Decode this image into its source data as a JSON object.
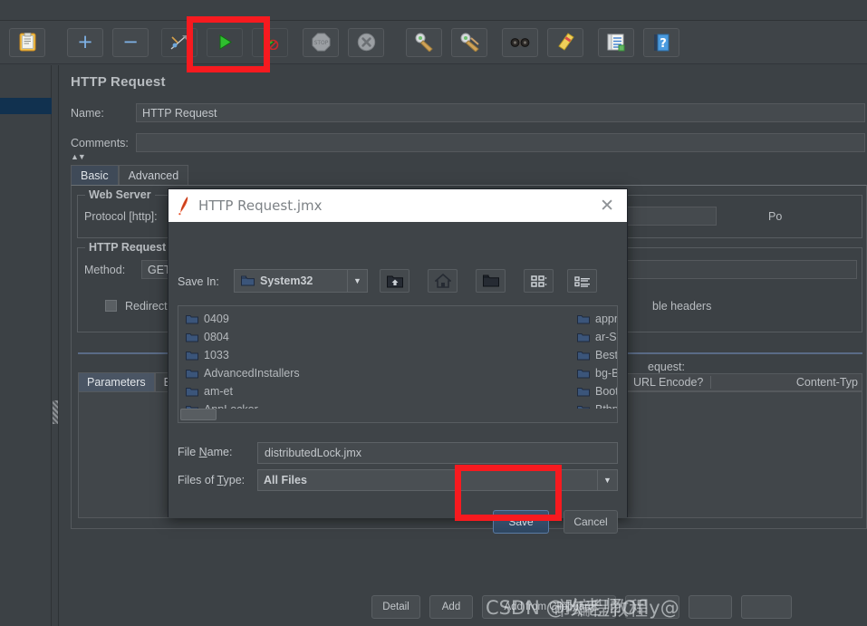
{
  "app": {
    "page_title": "HTTP Request"
  },
  "toolbar": {
    "buttons": [
      {
        "name": "templates-icon",
        "label": "Templates"
      },
      {
        "name": "add-icon",
        "label": "+"
      },
      {
        "name": "remove-icon",
        "label": "−"
      },
      {
        "name": "toggle-icon",
        "label": "Toggle"
      },
      {
        "name": "start-icon",
        "label": "Start"
      },
      {
        "name": "start-no-timers-icon",
        "label": "Start no pauses"
      },
      {
        "name": "stop-icon",
        "label": "Stop"
      },
      {
        "name": "shutdown-icon",
        "label": "Shutdown"
      },
      {
        "name": "clear-icon",
        "label": "Clear"
      },
      {
        "name": "clear-all-icon",
        "label": "Clear All"
      },
      {
        "name": "search-icon",
        "label": "Search"
      },
      {
        "name": "reset-search-icon",
        "label": "Reset Search"
      },
      {
        "name": "function-helper-icon",
        "label": "Function Helper Dialog"
      },
      {
        "name": "help-icon",
        "label": "Help"
      }
    ]
  },
  "editor": {
    "name_label": "Name:",
    "name_value": "HTTP Request",
    "comments_label": "Comments:",
    "comments_value": "",
    "tabs": [
      {
        "label": "Basic",
        "active": true
      },
      {
        "label": "Advanced",
        "active": false
      }
    ],
    "web_server_group": "Web Server",
    "protocol_label": "Protocol [http]:",
    "protocol_value": "",
    "port_label": "Po",
    "http_request_group": "HTTP Request",
    "method_label": "Method:",
    "method_value": "GET",
    "redirect_label": "Redirect Autor",
    "browser_headers_label": "ble headers",
    "send_params_label": "equest:",
    "param_tabs": [
      {
        "label": "Parameters",
        "active": true
      },
      {
        "label": "Bo",
        "active": false
      }
    ],
    "url_encode_header": "URL Encode?",
    "content_type_header": "Content-Typ",
    "bottom_buttons": [
      {
        "label": "Detail"
      },
      {
        "label": "Add"
      },
      {
        "label": "Add from Clipboard"
      },
      {
        "label": ""
      },
      {
        "label": ""
      },
      {
        "label": ""
      }
    ]
  },
  "dialog": {
    "title": "HTTP Request.jmx",
    "close_label": "✕",
    "save_in_label": "Save In:",
    "save_in_value": "System32",
    "nav_buttons": [
      {
        "name": "up-folder-icon",
        "label": "Up One Level"
      },
      {
        "name": "home-icon",
        "label": "Home"
      },
      {
        "name": "new-folder-icon",
        "label": "Create New Folder"
      },
      {
        "name": "grid-view-icon",
        "label": "List"
      },
      {
        "name": "list-view-icon",
        "label": "Details"
      }
    ],
    "files_col1": [
      "0409",
      "0804",
      "1033",
      "AdvancedInstallers",
      "am-et",
      "AppLocker"
    ],
    "files_col2": [
      "appr",
      "ar-S",
      "Best",
      "bg-B",
      "Boot",
      "Bthp"
    ],
    "file_name_label_pre": "File ",
    "file_name_label_mn": "N",
    "file_name_label_post": "ame:",
    "file_name_value": "distributedLock.jmx",
    "files_type_label_pre": "Files of ",
    "files_type_label_mn": "T",
    "files_type_label_post": "ype:",
    "files_type_value": "All Files",
    "save_label": "Save",
    "cancel_label": "Cancel"
  },
  "watermark": {
    "text": "CSDN @吹老师Ofly@",
    "text2": "市编程教程"
  },
  "colors": {
    "accent_red": "#f71a1f",
    "panel_bg": "#3c4145",
    "dialog_bg": "#3f4448",
    "save_blue": "#2e4660",
    "selection_blue": "#11314f"
  }
}
